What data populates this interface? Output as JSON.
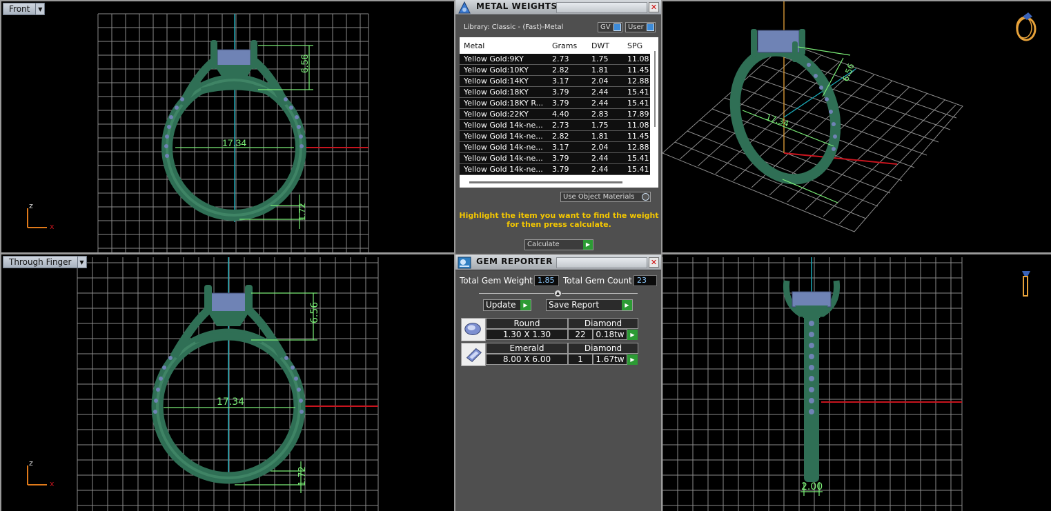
{
  "viewports": {
    "front": {
      "label": "Front"
    },
    "through_finger": {
      "label": "Through Finger"
    }
  },
  "dimensions": {
    "prong_height": "6.56",
    "ring_inner_diameter": "17.34",
    "shank_thickness": "1.72",
    "shank_width": "2.00"
  },
  "axes": {
    "z": "z",
    "x": "x"
  },
  "metal_weights": {
    "title": "METAL WEIGHTS",
    "library": "Library: Classic - (Fast)-Metal",
    "toggle_gv": "GV",
    "toggle_user": "User",
    "columns": [
      "Metal",
      "Grams",
      "DWT",
      "SPG"
    ],
    "rows": [
      [
        "Yellow Gold:9KY",
        "2.73",
        "1.75",
        "11.08"
      ],
      [
        "Yellow Gold:10KY",
        "2.82",
        "1.81",
        "11.45"
      ],
      [
        "Yellow Gold:14KY",
        "3.17",
        "2.04",
        "12.88"
      ],
      [
        "Yellow Gold:18KY",
        "3.79",
        "2.44",
        "15.41"
      ],
      [
        "Yellow Gold:18KY R...",
        "3.79",
        "2.44",
        "15.41"
      ],
      [
        "Yellow Gold:22KY",
        "4.40",
        "2.83",
        "17.89"
      ],
      [
        "Yellow Gold 14k-ne...",
        "2.73",
        "1.75",
        "11.08"
      ],
      [
        "Yellow Gold 14k-ne...",
        "2.82",
        "1.81",
        "11.45"
      ],
      [
        "Yellow Gold 14k-ne...",
        "3.17",
        "2.04",
        "12.88"
      ],
      [
        "Yellow Gold 14k-ne...",
        "3.79",
        "2.44",
        "15.41"
      ],
      [
        "Yellow Gold 14k-ne...",
        "3.79",
        "2.44",
        "15.41"
      ]
    ],
    "use_object_materials": "Use Object Materials",
    "hint_line1": "Highlight the item you want to find the weight",
    "hint_line2": "for then press calculate.",
    "calculate": "Calculate"
  },
  "gem_reporter": {
    "title": "GEM REPORTER",
    "total_weight_label": "Total Gem Weight",
    "total_weight_value": "1.85",
    "total_count_label": "Total Gem Count",
    "total_count_value": "23",
    "update": "Update",
    "save_report": "Save Report",
    "gems": [
      {
        "shape": "Round",
        "size": "1.30 X 1.30",
        "material": "Diamond",
        "count": "22",
        "weight": "0.18tw"
      },
      {
        "shape": "Emerald",
        "size": "8.00 X 6.00",
        "material": "Diamond",
        "count": "1",
        "weight": "1.67tw"
      }
    ]
  },
  "colors": {
    "ring": "#2f6f55",
    "gem": "#6f83b5",
    "dimension": "#7cf078",
    "grid": "#9a9a9a",
    "axis_red": "#c8141e",
    "axis_cyan": "#1aa8b6",
    "highlight": "#f5c800"
  }
}
